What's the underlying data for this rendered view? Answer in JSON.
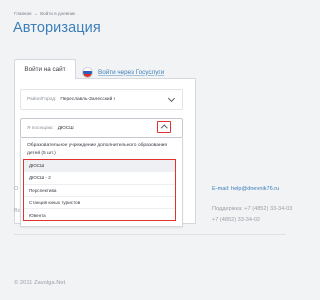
{
  "breadcrumb": {
    "home": "Главная",
    "separator": "→",
    "current": "Войти в дневник"
  },
  "page_title": "Авторизация",
  "tabs": {
    "login": "Войти на сайт",
    "gosuslugi": "Войти через Госуслуги"
  },
  "form": {
    "rayon": {
      "label": "Район/Город:",
      "value": "Переславль-Залесский г"
    },
    "school": {
      "label": "Я посещаю:",
      "value": "ДЮСШ"
    }
  },
  "dropdown": {
    "group_label": "Образовательное учреждение дополнительного образования детей (5 шт.)",
    "options": [
      "ДЮСШ",
      "ДЮСШ - 2",
      "Перспектива",
      "Станция юных туристов",
      "Ювента"
    ]
  },
  "footer": {
    "left_fragments": [
      "О",
      "Во"
    ],
    "email": "E-mail: help@dnevnik76.ru",
    "phones": [
      "Поддержка: +7 (4852) 33-34-03",
      "+7 (4852) 33-34-02"
    ],
    "copyright": "© 2011 Zavolga.Net"
  },
  "colors": {
    "accent": "#3a7fb9",
    "highlight_border": "#e23131",
    "background": "#f2f3f5"
  }
}
